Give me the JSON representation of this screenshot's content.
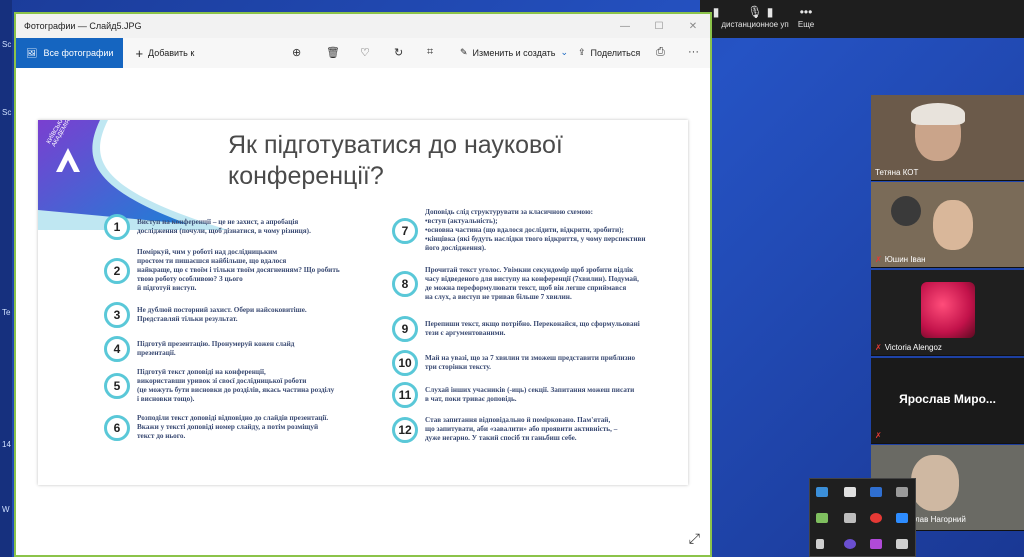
{
  "window": {
    "title": "Фотографии — Слайд5.JPG",
    "controls": [
      "—",
      "☐",
      "✕"
    ]
  },
  "toolbar": {
    "all_photos": "Все фотографии",
    "add": "Добавить к",
    "edit_create": "Изменить и создать",
    "share": "Поделиться"
  },
  "zoom_bar": {
    "items": [
      {
        "icon": "▮",
        "label": ""
      },
      {
        "icon": "▮",
        "label": ""
      },
      {
        "icon": "57",
        "label": ""
      },
      {
        "icon": "🎙",
        "label": "дистанционное уп"
      },
      {
        "icon": "•••",
        "label": "Еще"
      }
    ]
  },
  "desktop": {
    "edge_labels": [
      "Sc",
      "Sc",
      "Te",
      "14",
      "W"
    ]
  },
  "slide": {
    "title": "Як підготуватися до наукової конференції?",
    "logo_text": "КИЇВСЬКА МАЛА АКАДЕМІЯ НАУК",
    "items_left": [
      {
        "num": "1",
        "text": "Виступ на конференції – це не захист, а апробація\nдослідження (почули, щоб дізнатися, в чому різниця)."
      },
      {
        "num": "2",
        "text": "Поміркуй, чим у роботі над дослідницьким\nпростом ти пишаєшся найбільше, що вдалося\nнайкраще, що є твоїм і тільки твоїм досягненням? Що робить\nтвою роботу особливою? З цього\nй підготуй виступ."
      },
      {
        "num": "3",
        "text": "Не дублюй посторний захист. Обери найсоковитіше.\nПредставляй тільки результат."
      },
      {
        "num": "4",
        "text": "Підготуй презентацію. Пронумеруй кожен слайд\nпрезентації."
      },
      {
        "num": "5",
        "text": "Підготуй текст доповіді на конференції,\nвикориставши уривок зі своєї дослідницької роботи\n(це можуть бути висновки до розділів, якась частина розділу\nі висновки тощо)."
      },
      {
        "num": "6",
        "text": "Розподіли текст доповіді відповідно до слайдів презентації.\nВкажи у тексті доповіді номер слайду, а потім розміщуй\nтекст до нього."
      }
    ],
    "items_right": [
      {
        "num": "7",
        "text": "Доповідь слід структурувати за класичною схемою:\n•вступ (актуальність);\n•основна частина (що вдалося дослідити, відкрити, зробити);\n•кінцівка (які будуть наслідки твого відкриття, у чому перспективи\nйого дослідження)."
      },
      {
        "num": "8",
        "text": "Прочитай текст уголос. Увімкни секундомір щоб зробити відлік\nчасу відведеного для виступу на конференції (7хвилин). Подумай,\nде можна переформулювати текст, щоб він легше сприймався\nна слух, а виступ не тривав більше 7 хвилин."
      },
      {
        "num": "9",
        "text": "Перепиши текст, якщо потрібно. Переконайся, що сформульовані\nтези є аргументованими."
      },
      {
        "num": "10",
        "text": "Май на увазі, що за 7 хвилин ти зможеш представити приблизно\nтри сторінки тексту."
      },
      {
        "num": "11",
        "text": "Слухай інших учасників (-иць) секції. Запитання можеш писати\nв чат, поки триває доповідь."
      },
      {
        "num": "12",
        "text": "Став запитання відповідально й помірковано. Пам'ятай,\nщо запитувати, аби «завалити» або проявити активність, –\nдуже негарно. У такий спосіб ти ганьбиш себе."
      }
    ]
  },
  "participants": [
    {
      "name": "Тетяна КОТ",
      "muted": false
    },
    {
      "name": "Юшин Іван",
      "muted": true
    },
    {
      "name": "Victoria Alengoz",
      "muted": true
    },
    {
      "name": "Ярослав Миро...",
      "muted": true,
      "no_video": true
    },
    {
      "name": "лав Нагорний",
      "muted": false
    }
  ],
  "colors": {
    "accent": "#1565c0",
    "window_border": "#8bc34a",
    "num_ring": "#5ac8d8",
    "slide_text": "#3b4b73"
  }
}
